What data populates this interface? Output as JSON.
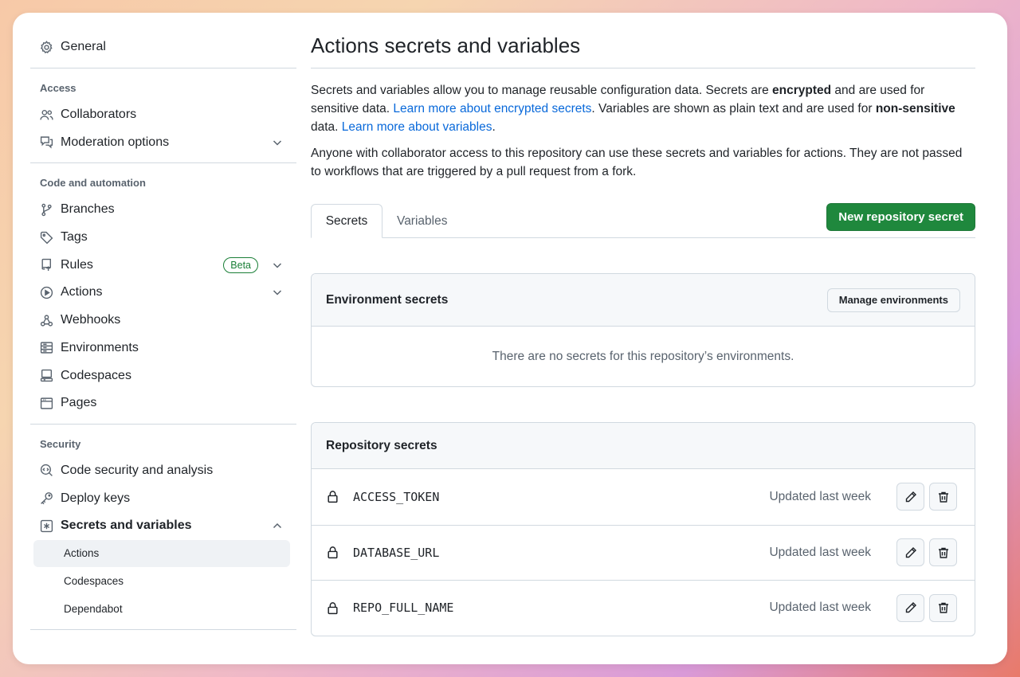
{
  "sidebar": {
    "general": {
      "label": "General",
      "icon": "gear-icon"
    },
    "sections": {
      "access": {
        "title": "Access",
        "items": [
          {
            "label": "Collaborators",
            "icon": "people-icon"
          },
          {
            "label": "Moderation options",
            "icon": "comment-discussion-icon",
            "expandable": true
          }
        ]
      },
      "code": {
        "title": "Code and automation",
        "items": [
          {
            "label": "Branches",
            "icon": "git-branch-icon"
          },
          {
            "label": "Tags",
            "icon": "tag-icon"
          },
          {
            "label": "Rules",
            "icon": "repo-push-icon",
            "badge": "Beta",
            "expandable": true
          },
          {
            "label": "Actions",
            "icon": "play-icon",
            "expandable": true
          },
          {
            "label": "Webhooks",
            "icon": "webhook-icon"
          },
          {
            "label": "Environments",
            "icon": "server-icon"
          },
          {
            "label": "Codespaces",
            "icon": "codespaces-icon"
          },
          {
            "label": "Pages",
            "icon": "browser-icon"
          }
        ]
      },
      "security": {
        "title": "Security",
        "items": [
          {
            "label": "Code security and analysis",
            "icon": "codescan-icon"
          },
          {
            "label": "Deploy keys",
            "icon": "key-icon"
          },
          {
            "label": "Secrets and variables",
            "icon": "asterisk-icon",
            "expanded": true
          }
        ],
        "subitems": [
          {
            "label": "Actions",
            "active": true
          },
          {
            "label": "Codespaces"
          },
          {
            "label": "Dependabot"
          }
        ]
      }
    }
  },
  "main": {
    "title": "Actions secrets and variables",
    "desc1": {
      "t1": "Secrets and variables allow you to manage reusable configuration data. Secrets are ",
      "b1": "encrypted",
      "t2": " and are used for sensitive data. ",
      "link1": "Learn more about encrypted secrets",
      "t3": ". Variables are shown as plain text and are used for ",
      "b2": "non-sensitive",
      "t4": " data. ",
      "link2": "Learn more about variables",
      "t5": "."
    },
    "desc2": "Anyone with collaborator access to this repository can use these secrets and variables for actions. They are not passed to workflows that are triggered by a pull request from a fork.",
    "tabs": [
      {
        "label": "Secrets",
        "active": true
      },
      {
        "label": "Variables"
      }
    ],
    "new_secret_button": "New repository secret",
    "environment_secrets": {
      "title": "Environment secrets",
      "manage_button": "Manage environments",
      "empty_text": "There are no secrets for this repository’s environments."
    },
    "repository_secrets": {
      "title": "Repository secrets",
      "rows": [
        {
          "name": "ACCESS_TOKEN",
          "updated": "Updated last week"
        },
        {
          "name": "DATABASE_URL",
          "updated": "Updated last week"
        },
        {
          "name": "REPO_FULL_NAME",
          "updated": "Updated last week"
        }
      ]
    }
  },
  "colors": {
    "primary_button": "#1f883d",
    "link": "#0969da",
    "badge": "#1a7f37"
  }
}
